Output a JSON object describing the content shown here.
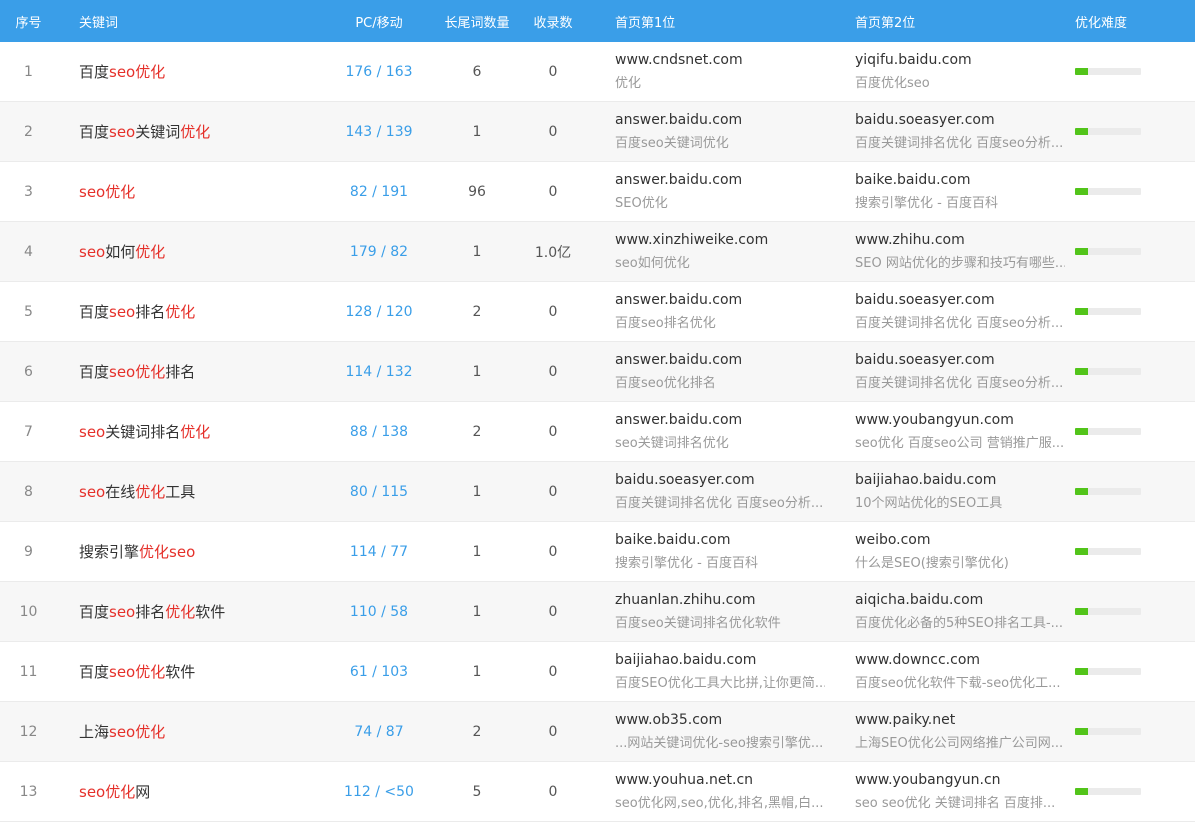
{
  "header": {
    "idx": "序号",
    "keyword": "关键词",
    "pc_mobile": "PC/移动",
    "long_tail": "长尾词数量",
    "indexed": "收录数",
    "rank1": "首页第1位",
    "rank2": "首页第2位",
    "difficulty": "优化难度"
  },
  "colors": {
    "header_bg": "#3a9ee8",
    "highlight": "#e5302a",
    "link_blue": "#3a9ee8",
    "bar_fill": "#52c41a"
  },
  "rows": [
    {
      "idx": "1",
      "kw": [
        {
          "t": "百度",
          "h": false
        },
        {
          "t": "seo",
          "h": true
        },
        {
          "t": "优化",
          "h": true
        }
      ],
      "pcm": "176 / 163",
      "long": "6",
      "indexed": "0",
      "r1_domain": "www.cndsnet.com",
      "r1_title": "优化",
      "r2_domain": "yiqifu.baidu.com",
      "r2_title": "百度优化seo",
      "difficulty": 0.2
    },
    {
      "idx": "2",
      "kw": [
        {
          "t": "百度",
          "h": false
        },
        {
          "t": "seo",
          "h": true
        },
        {
          "t": "关键词",
          "h": false
        },
        {
          "t": "优化",
          "h": true
        }
      ],
      "pcm": "143 / 139",
      "long": "1",
      "indexed": "0",
      "r1_domain": "answer.baidu.com",
      "r1_title": "百度seo关键词优化",
      "r2_domain": "baidu.soeasyer.com",
      "r2_title": "百度关键词排名优化 百度seo分析...",
      "difficulty": 0.2
    },
    {
      "idx": "3",
      "kw": [
        {
          "t": "seo",
          "h": true
        },
        {
          "t": "优化",
          "h": true
        }
      ],
      "pcm": "82 / 191",
      "long": "96",
      "indexed": "0",
      "r1_domain": "answer.baidu.com",
      "r1_title": "SEO优化",
      "r2_domain": "baike.baidu.com",
      "r2_title": "搜索引擎优化 - 百度百科",
      "difficulty": 0.2
    },
    {
      "idx": "4",
      "kw": [
        {
          "t": "seo",
          "h": true
        },
        {
          "t": "如何",
          "h": false
        },
        {
          "t": "优化",
          "h": true
        }
      ],
      "pcm": "179 / 82",
      "long": "1",
      "indexed": "1.0亿",
      "r1_domain": "www.xinzhiweike.com",
      "r1_title": "seo如何优化",
      "r2_domain": "www.zhihu.com",
      "r2_title": "SEO 网站优化的步骤和技巧有哪些...",
      "difficulty": 0.2
    },
    {
      "idx": "5",
      "kw": [
        {
          "t": "百度",
          "h": false
        },
        {
          "t": "seo",
          "h": true
        },
        {
          "t": "排名",
          "h": false
        },
        {
          "t": "优化",
          "h": true
        }
      ],
      "pcm": "128 / 120",
      "long": "2",
      "indexed": "0",
      "r1_domain": "answer.baidu.com",
      "r1_title": "百度seo排名优化",
      "r2_domain": "baidu.soeasyer.com",
      "r2_title": "百度关键词排名优化 百度seo分析...",
      "difficulty": 0.2
    },
    {
      "idx": "6",
      "kw": [
        {
          "t": "百度",
          "h": false
        },
        {
          "t": "seo",
          "h": true
        },
        {
          "t": "优化",
          "h": true
        },
        {
          "t": "排名",
          "h": false
        }
      ],
      "pcm": "114 / 132",
      "long": "1",
      "indexed": "0",
      "r1_domain": "answer.baidu.com",
      "r1_title": "百度seo优化排名",
      "r2_domain": "baidu.soeasyer.com",
      "r2_title": "百度关键词排名优化 百度seo分析...",
      "difficulty": 0.2
    },
    {
      "idx": "7",
      "kw": [
        {
          "t": "seo",
          "h": true
        },
        {
          "t": "关键词排名",
          "h": false
        },
        {
          "t": "优化",
          "h": true
        }
      ],
      "pcm": "88 / 138",
      "long": "2",
      "indexed": "0",
      "r1_domain": "answer.baidu.com",
      "r1_title": "seo关键词排名优化",
      "r2_domain": "www.youbangyun.com",
      "r2_title": "seo优化 百度seo公司 营销推广服...",
      "difficulty": 0.2
    },
    {
      "idx": "8",
      "kw": [
        {
          "t": "seo",
          "h": true
        },
        {
          "t": "在线",
          "h": false
        },
        {
          "t": "优化",
          "h": true
        },
        {
          "t": "工具",
          "h": false
        }
      ],
      "pcm": "80 / 115",
      "long": "1",
      "indexed": "0",
      "r1_domain": "baidu.soeasyer.com",
      "r1_title": "百度关键词排名优化 百度seo分析...",
      "r2_domain": "baijiahao.baidu.com",
      "r2_title": "10个网站优化的SEO工具",
      "difficulty": 0.2
    },
    {
      "idx": "9",
      "kw": [
        {
          "t": "搜索引擎",
          "h": false
        },
        {
          "t": "优化",
          "h": true
        },
        {
          "t": "seo",
          "h": true
        }
      ],
      "pcm": "114 / 77",
      "long": "1",
      "indexed": "0",
      "r1_domain": "baike.baidu.com",
      "r1_title": "搜索引擎优化 - 百度百科",
      "r2_domain": "weibo.com",
      "r2_title": "什么是SEO(搜索引擎优化)",
      "difficulty": 0.2
    },
    {
      "idx": "10",
      "kw": [
        {
          "t": "百度",
          "h": false
        },
        {
          "t": "seo",
          "h": true
        },
        {
          "t": "排名",
          "h": false
        },
        {
          "t": "优化",
          "h": true
        },
        {
          "t": "软件",
          "h": false
        }
      ],
      "pcm": "110 / 58",
      "long": "1",
      "indexed": "0",
      "r1_domain": "zhuanlan.zhihu.com",
      "r1_title": "百度seo关键词排名优化软件",
      "r2_domain": "aiqicha.baidu.com",
      "r2_title": "百度优化必备的5种SEO排名工具-...",
      "difficulty": 0.2
    },
    {
      "idx": "11",
      "kw": [
        {
          "t": "百度",
          "h": false
        },
        {
          "t": "seo",
          "h": true
        },
        {
          "t": "优化",
          "h": true
        },
        {
          "t": "软件",
          "h": false
        }
      ],
      "pcm": "61 / 103",
      "long": "1",
      "indexed": "0",
      "r1_domain": "baijiahao.baidu.com",
      "r1_title": "百度SEO优化工具大比拼,让你更简...",
      "r2_domain": "www.downcc.com",
      "r2_title": "百度seo优化软件下载-seo优化工...",
      "difficulty": 0.2
    },
    {
      "idx": "12",
      "kw": [
        {
          "t": "上海",
          "h": false
        },
        {
          "t": "seo",
          "h": true
        },
        {
          "t": "优化",
          "h": true
        }
      ],
      "pcm": "74 / 87",
      "long": "2",
      "indexed": "0",
      "r1_domain": "www.ob35.com",
      "r1_title": "...网站关键词优化-seo搜索引擎优...",
      "r2_domain": "www.paiky.net",
      "r2_title": "上海SEO优化公司网络推广公司网...",
      "difficulty": 0.2
    },
    {
      "idx": "13",
      "kw": [
        {
          "t": "seo",
          "h": true
        },
        {
          "t": "优化",
          "h": true
        },
        {
          "t": "网",
          "h": false
        }
      ],
      "pcm": "112 / <50",
      "long": "5",
      "indexed": "0",
      "r1_domain": "www.youhua.net.cn",
      "r1_title": "seo优化网,seo,优化,排名,黑帽,白...",
      "r2_domain": "www.youbangyun.cn",
      "r2_title": "seo seo优化 关键词排名 百度排...",
      "difficulty": 0.2
    }
  ]
}
